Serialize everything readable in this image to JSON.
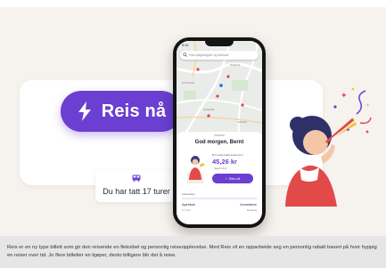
{
  "hero": {
    "button_label": "Reis nå",
    "trips_text": "Du har tatt 17 turer"
  },
  "phone": {
    "status_time": "9:41",
    "search_placeholder": "Hva nyagutingner og Adresse",
    "map_labels": [
      "BJERKE",
      "NYDALEN",
      "SAGENE",
      "SINSEN"
    ],
    "greeting": "God morgen, Bernt",
    "offer_label": "Din neste bilett koster kun",
    "price": "45,26 kr",
    "price_note": "Spart 14 kr",
    "button_label": "Reis nå",
    "section_label": "Ladestatus",
    "bottom_left": "Kjøreliste",
    "bottom_right": "Anmeldelse",
    "bottom_left_sub": "17 turer",
    "bottom_right_sub": "Betaling"
  },
  "caption": "Reis er en ny type billett som gir den reisende en fleksibel og personlig reiseopplevelse. Med Reis vil en opparbeide seg en personlig rabatt basert på hvor hyppig en reiser over tid. Jo flere billetter en kjøper, desto billigere blir det å reise.",
  "colors": {
    "accent": "#6b3fd1",
    "background": "#f6f2ee",
    "caption_bg": "#e6e6e6"
  },
  "icons": [
    "lightning-icon",
    "bus-icon",
    "search-icon",
    "plus-icon"
  ]
}
